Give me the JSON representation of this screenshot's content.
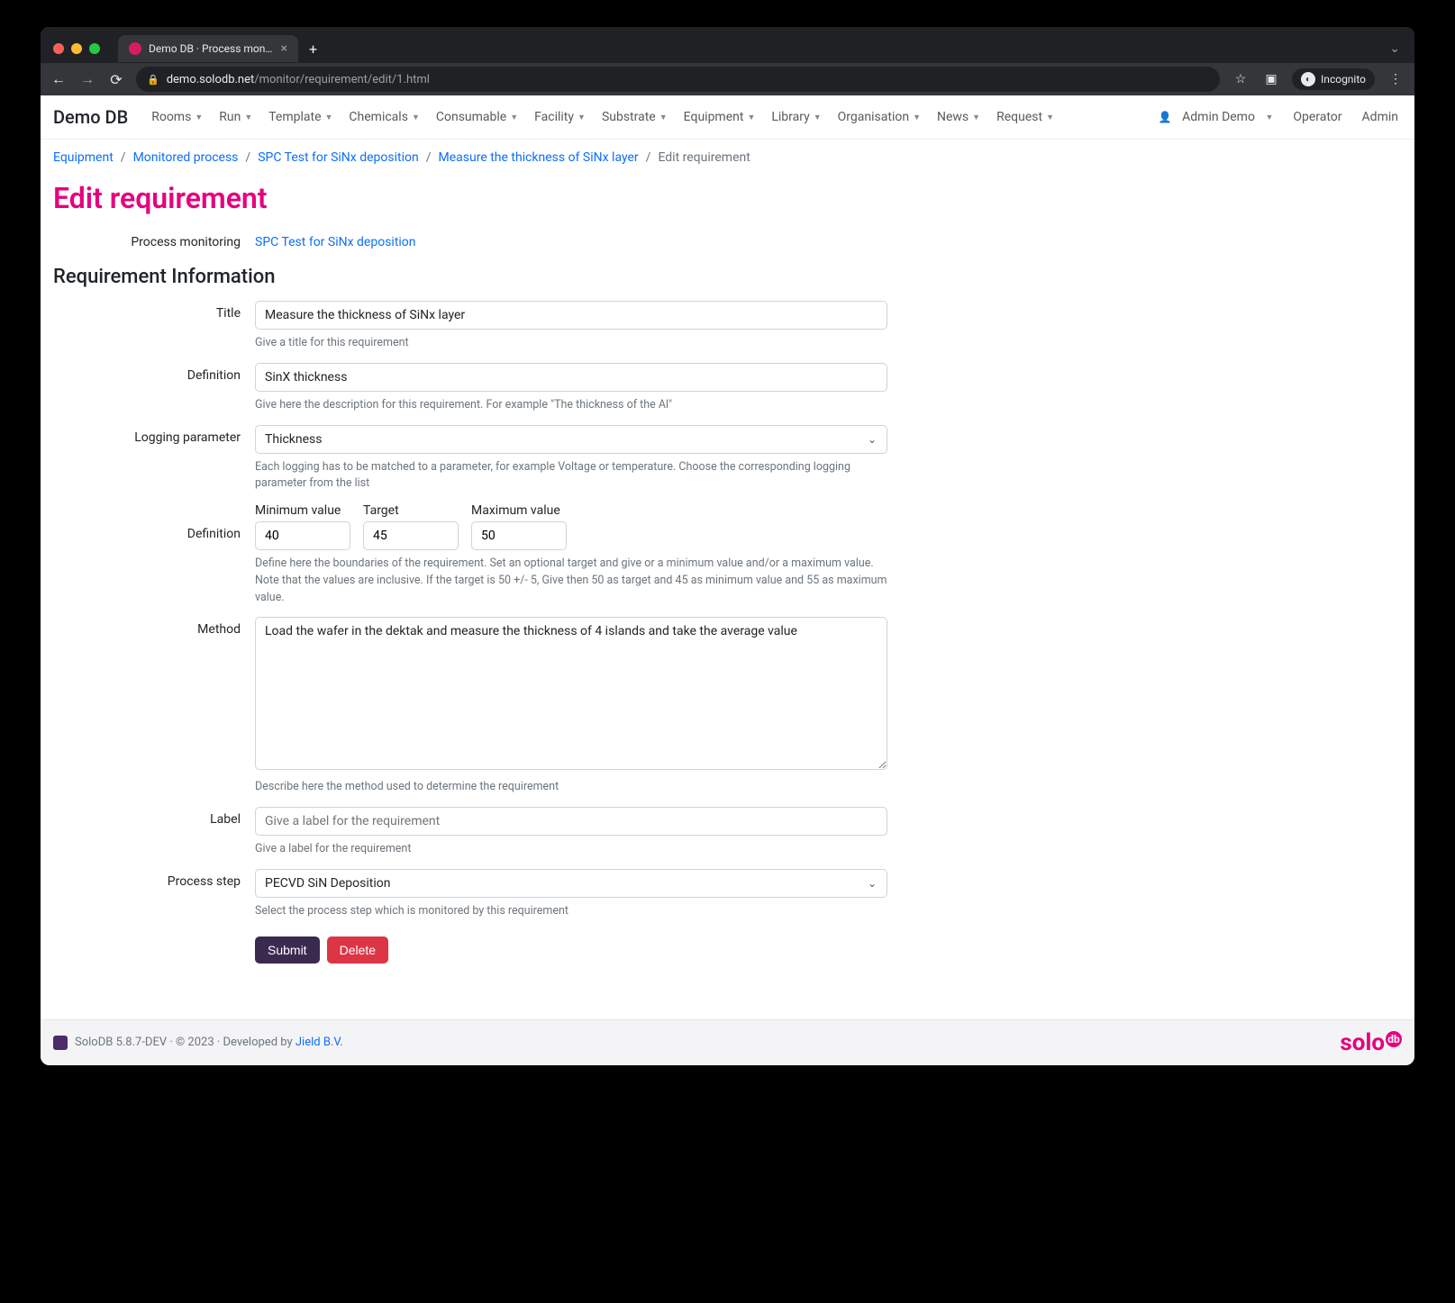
{
  "browser": {
    "tab_title": "Demo DB · Process monitoring",
    "url_host": "demo.solodb.net",
    "url_path": "/monitor/requirement/edit/1.html",
    "incognito_label": "Incognito"
  },
  "navbar": {
    "brand": "Demo DB",
    "links": [
      "Rooms",
      "Run",
      "Template",
      "Chemicals",
      "Consumable",
      "Facility",
      "Substrate",
      "Equipment",
      "Library",
      "Organisation",
      "News",
      "Request"
    ],
    "user_label": "Admin Demo",
    "right_links": [
      "Operator",
      "Admin"
    ]
  },
  "breadcrumb": {
    "items": [
      "Equipment",
      "Monitored process",
      "SPC Test for SiNx deposition",
      "Measure the thickness of SiNx layer"
    ],
    "active": "Edit requirement"
  },
  "page": {
    "title": "Edit requirement",
    "process_monitoring_label": "Process monitoring",
    "process_monitoring_link": "SPC Test for SiNx deposition",
    "section": "Requirement Information",
    "fields": {
      "title": {
        "label": "Title",
        "value": "Measure the thickness of SiNx layer",
        "help": "Give a title for this requirement"
      },
      "definition": {
        "label": "Definition",
        "value": "SinX thickness",
        "help": "Give here the description for this requirement. For example \"The thickness of the Al\""
      },
      "logging_param": {
        "label": "Logging parameter",
        "value": "Thickness",
        "help": "Each logging has to be matched to a parameter, for example Voltage or temperature. Choose the corresponding logging parameter from the list"
      },
      "bounds": {
        "label": "Definition",
        "min_label": "Minimum value",
        "min_value": "40",
        "target_label": "Target",
        "target_value": "45",
        "max_label": "Maximum value",
        "max_value": "50",
        "help": "Define here the boundaries of the requirement. Set an optional target and give or a minimum value and/or a maximum value. Note that the values are inclusive. If the target is 50 +/- 5, Give then 50 as target and 45 as minimum value and 55 as maximum value."
      },
      "method": {
        "label": "Method",
        "value": "Load the wafer in the dektak and measure the thickness of 4 islands and take the average value",
        "help": "Describe here the method used to determine the requirement"
      },
      "label_field": {
        "label": "Label",
        "placeholder": "Give a label for the requirement",
        "help": "Give a label for the requirement"
      },
      "process_step": {
        "label": "Process step",
        "value": "PECVD SiN Deposition",
        "help": "Select the process step which is monitored by this requirement"
      }
    },
    "buttons": {
      "submit": "Submit",
      "delete": "Delete"
    }
  },
  "footer": {
    "text_pre": "SoloDB 5.8.7-DEV · © 2023 · Developed by ",
    "link": "Jield B.V.",
    "logo_text": "solo",
    "logo_sup": "db"
  }
}
